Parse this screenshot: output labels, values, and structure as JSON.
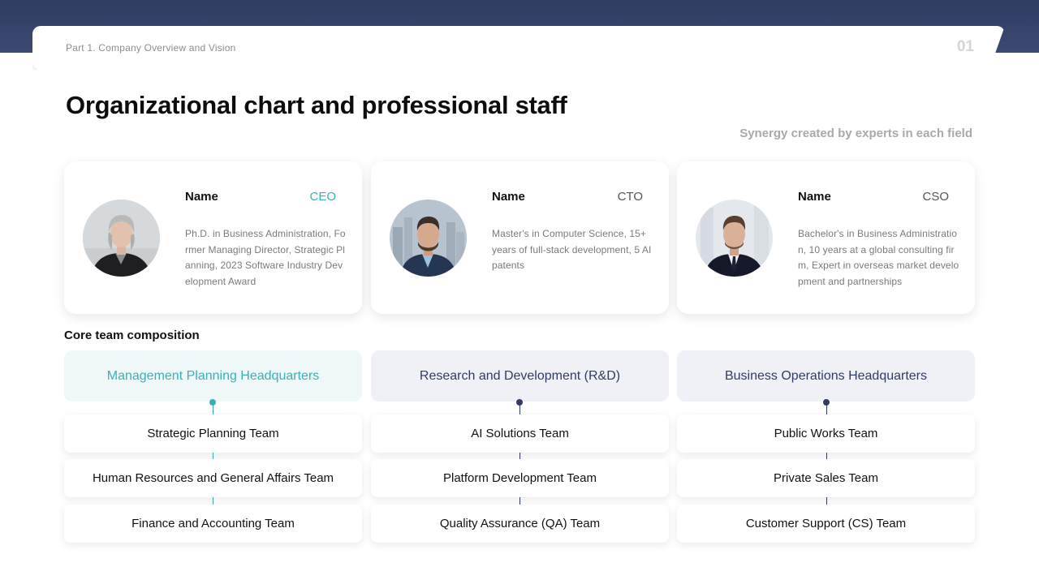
{
  "header": {
    "breadcrumb": "Part 1. Company Overview and Vision",
    "page_number": "01"
  },
  "title": "Organizational chart and professional staff",
  "subtitle": "Synergy created by experts in each field",
  "colors": {
    "navy": "#2f3d63",
    "teal": "#3ab0b4",
    "light_gray_bg": "#eff1f7",
    "light_teal_bg": "#eff8f8"
  },
  "executives": [
    {
      "name": "Name",
      "role": "CEO",
      "description": "Ph.D. in Business Administration, Former Managing Director, Strategic Planning, 2023 Software Industry Development Award",
      "photo": "woman-portrait"
    },
    {
      "name": "Name",
      "role": "CTO",
      "description": "Master's in Computer Science, 15+ years of full-stack development, 5 AI patents",
      "photo": "man-portrait-city"
    },
    {
      "name": "Name",
      "role": "CSO",
      "description": "Bachelor's in Business Administration, 10 years at a global consulting firm, Expert in overseas market development and partnerships",
      "photo": "man-portrait-office"
    }
  ],
  "core_team": {
    "label": "Core team composition",
    "departments": [
      {
        "name": "Management Planning Headquarters",
        "teams": [
          "Strategic Planning Team",
          "Human Resources and General Affairs Team",
          "Finance and Accounting Team"
        ]
      },
      {
        "name": "Research and Development (R&D)",
        "teams": [
          "AI Solutions Team",
          "Platform Development Team",
          "Quality Assurance (QA) Team"
        ]
      },
      {
        "name": "Business Operations Headquarters",
        "teams": [
          "Public Works Team",
          "Private Sales Team",
          "Customer Support (CS) Team"
        ]
      }
    ]
  }
}
